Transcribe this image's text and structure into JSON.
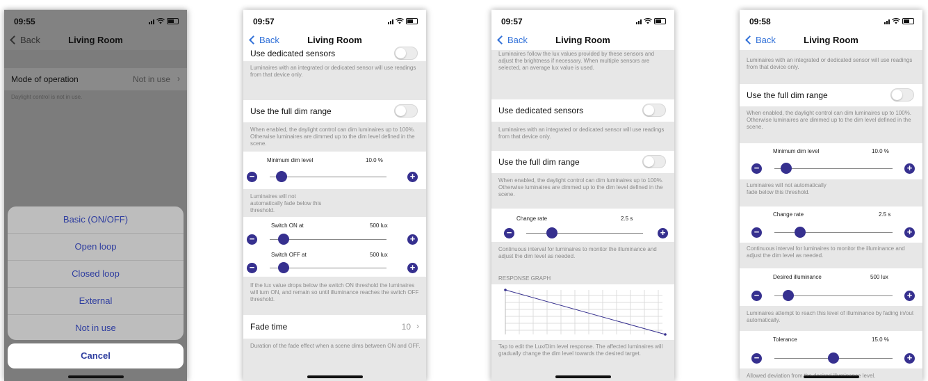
{
  "screen1": {
    "time": "09:55",
    "nav": {
      "back": "Back",
      "title": "Living Room"
    },
    "mode": {
      "label": "Mode of operation",
      "value": "Not in use"
    },
    "note": "Daylight control is not in use.",
    "sheet_options": [
      "Basic (ON/OFF)",
      "Open loop",
      "Closed loop",
      "External",
      "Not in use"
    ],
    "cancel": "Cancel"
  },
  "screen2": {
    "time": "09:57",
    "nav": {
      "back": "Back",
      "title": "Living Room"
    },
    "sensors": {
      "label": "Use dedicated sensors",
      "desc": "Luminaires with an integrated or dedicated sensor will use readings from that device only."
    },
    "fulldim": {
      "label": "Use the full dim range",
      "desc": "When enabled, the daylight control can dim luminaires up to 100%. Otherwise luminaires are dimmed up to the dim level defined in the scene."
    },
    "mindim": {
      "label": "Minimum dim level",
      "value": "10.0 %",
      "fraction": 0.1,
      "desc": "Luminaires will not automatically fade below this threshold."
    },
    "switch_on": {
      "label": "Switch ON at",
      "value": "500 lux",
      "fraction": 0.12
    },
    "switch_off": {
      "label": "Switch OFF at",
      "value": "500 lux",
      "fraction": 0.12
    },
    "switch_desc": "If the lux value drops below the switch ON threshold the luminaires will turn ON, and remain so until illuminance reaches the switch OFF threshold.",
    "fade": {
      "label": "Fade time",
      "value": "10",
      "desc": "Duration of the fade effect when a scene dims between ON and OFF."
    }
  },
  "screen3": {
    "time": "09:57",
    "nav": {
      "back": "Back",
      "title": "Living Room"
    },
    "top_desc": "Luminaires follow the lux values provided by these sensors and adjust the brightness if necessary. When multiple sensors are selected, an average lux value is used.",
    "sensors": {
      "label": "Use dedicated sensors",
      "desc": "Luminaires with an integrated or dedicated sensor will use readings from that device only."
    },
    "fulldim": {
      "label": "Use the full dim range",
      "desc": "When enabled, the daylight control can dim luminaires up to 100%. Otherwise luminaires are dimmed up to the dim level defined in the scene."
    },
    "change_rate": {
      "label": "Change rate",
      "value": "2.5 s",
      "fraction": 0.22,
      "desc": "Continuous interval for luminaires to monitor the illuminance and adjust the dim level as needed."
    },
    "graph": {
      "heading": "RESPONSE GRAPH",
      "desc": "Tap to edit the Lux/Dim level response. The affected luminaires will gradually change the dim level towards the desired target."
    }
  },
  "screen4": {
    "time": "09:58",
    "nav": {
      "back": "Back",
      "title": "Living Room"
    },
    "top_desc": "Luminaires with an integrated or dedicated sensor will use readings from that device only.",
    "fulldim": {
      "label": "Use the full dim range",
      "desc": "When enabled, the daylight control can dim luminaires up to 100%. Otherwise luminaires are dimmed up to the dim level defined in the scene."
    },
    "mindim": {
      "label": "Minimum dim level",
      "value": "10.0 %",
      "fraction": 0.1,
      "desc": "Luminaires will not automatically fade below this threshold."
    },
    "change_rate": {
      "label": "Change rate",
      "value": "2.5 s",
      "fraction": 0.22,
      "desc": "Continuous interval for luminaires to monitor the illuminance and adjust the dim level as needed."
    },
    "illuminance": {
      "label": "Desired illuminance",
      "value": "500 lux",
      "fraction": 0.12,
      "desc": "Luminaires attempt to reach this level of illuminance by fading in/out automatically."
    },
    "tolerance": {
      "label": "Tolerance",
      "value": "15.0 %",
      "fraction": 0.5,
      "desc": "Allowed deviation from the desired illuminance level."
    }
  },
  "colors": {
    "accent": "#36308f",
    "link": "#2f6fd8",
    "group_bg": "#e7e7e7"
  }
}
